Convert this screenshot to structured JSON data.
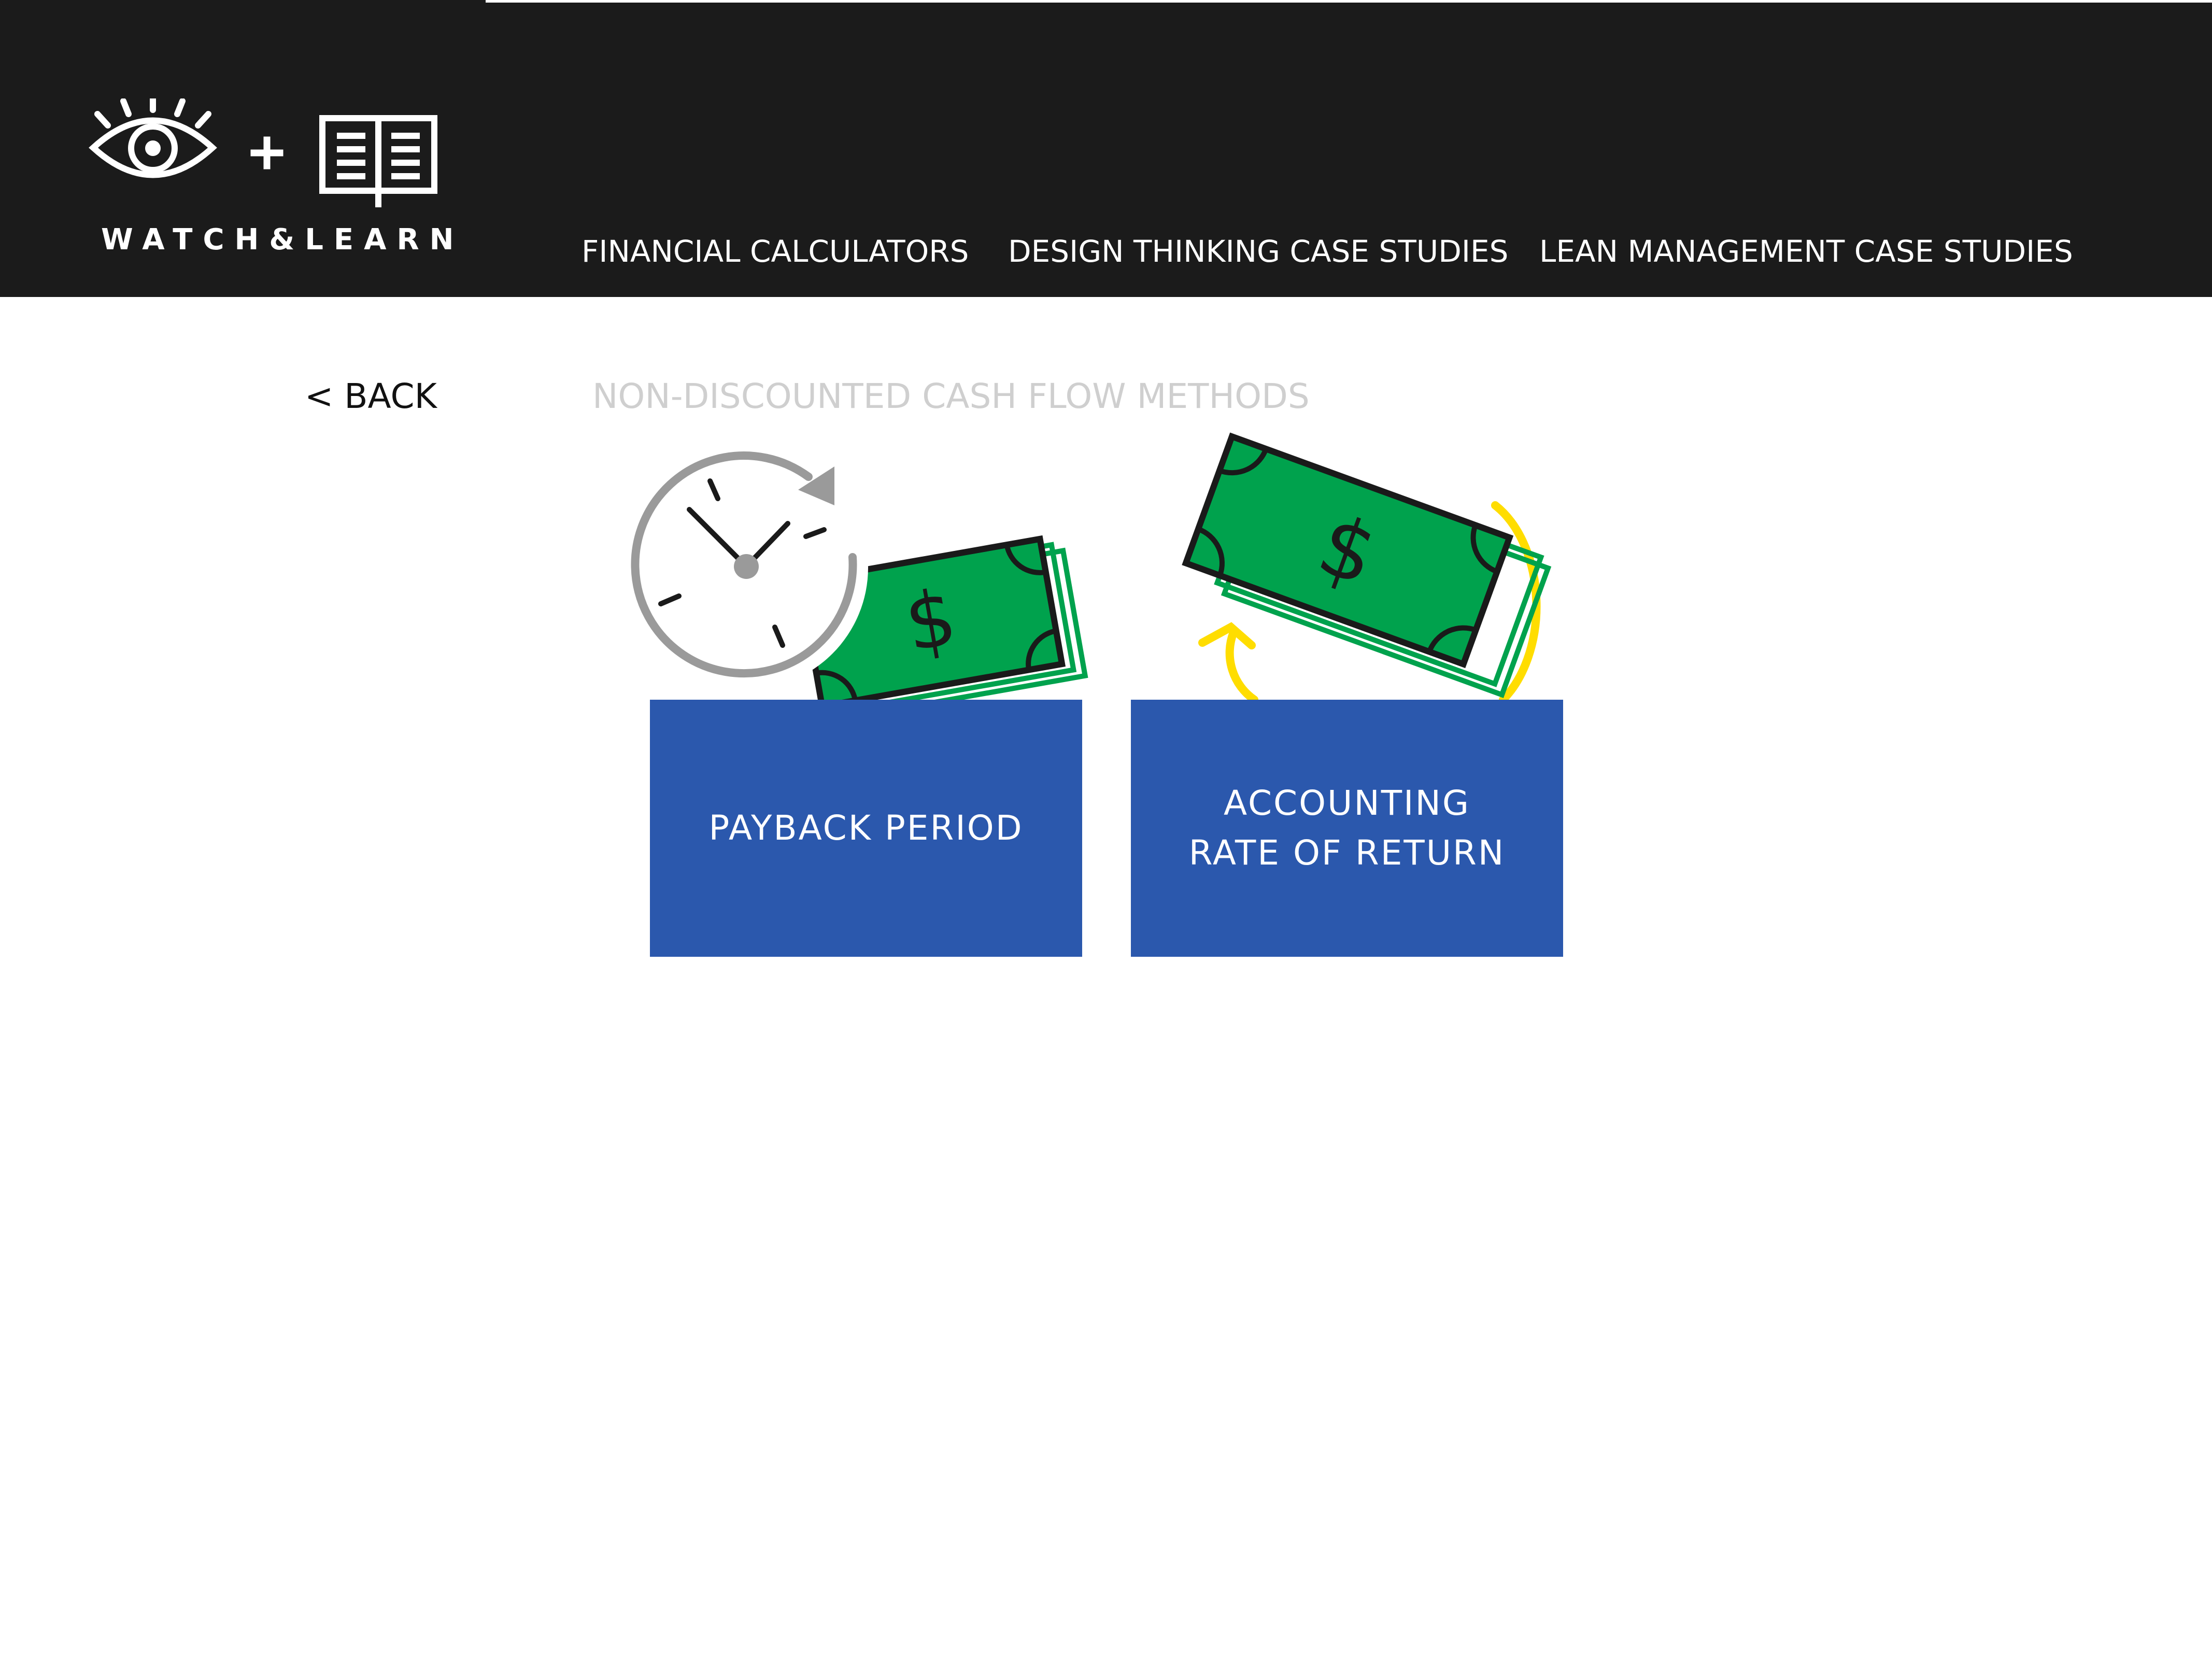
{
  "logo": {
    "eye_icon": "eye-icon",
    "plus_icon": "plus-icon",
    "book_icon": "open-book-icon",
    "wordmark": "WATCH&LEARN"
  },
  "nav": {
    "items": [
      "FINANCIAL CALCULATORS",
      "DESIGN THINKING CASE STUDIES",
      "LEAN MANAGEMENT CASE STUDIES"
    ]
  },
  "back": {
    "label": "< BACK"
  },
  "section": {
    "title": "NON-DISCOUNTED CASH FLOW METHODS"
  },
  "cards": [
    {
      "lines": [
        "PAYBACK PERIOD"
      ],
      "icons": [
        "clock-icon",
        "dollar-bill-icon"
      ]
    },
    {
      "lines": [
        "ACCOUNTING",
        "RATE OF RETURN"
      ],
      "icons": [
        "circular-arrow-icon",
        "dollar-bill-icon"
      ]
    }
  ],
  "colors": {
    "header_bg": "#1b1b1b",
    "card_bg": "#2b58ad",
    "bill_green": "#00a24d",
    "arrow_yellow": "#ffdd00",
    "clock_gray": "#9a9a9a",
    "title_gray": "#cfcfcf"
  }
}
